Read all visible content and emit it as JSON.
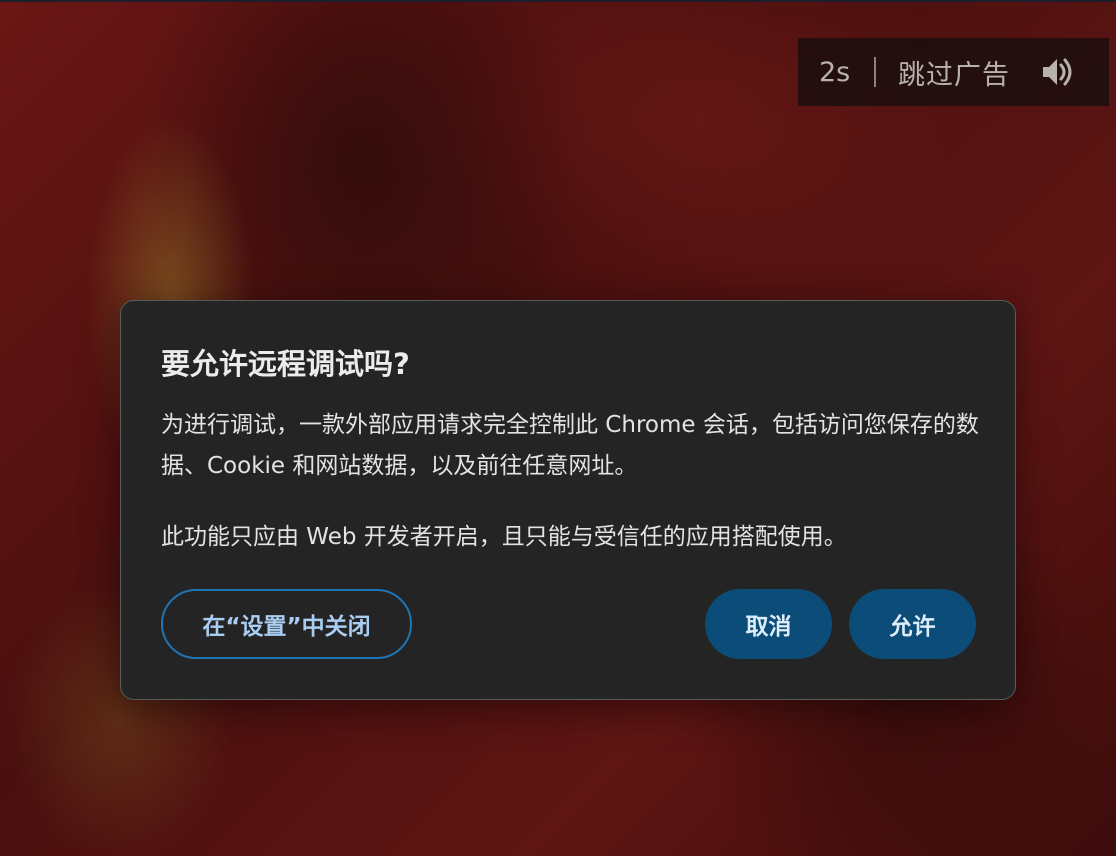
{
  "ad": {
    "countdown": "2s",
    "skip_label": "跳过广告",
    "speaker_icon": "speaker-icon"
  },
  "dialog": {
    "title": "要允许远程调试吗?",
    "body_line1": "为进行调试，一款外部应用请求完全控制此 Chrome 会话，包括访问您保存的数据、Cookie 和网站数据，以及前往任意网址。",
    "body_line2": "此功能只应由 Web 开发者开启，且只能与受信任的应用搭配使用。",
    "settings_button": "在“设置”中关闭",
    "cancel_button": "取消",
    "allow_button": "允许"
  },
  "colors": {
    "dialog_bg": "#242424",
    "primary_button": "#0b4c79",
    "outline_button_border": "#1f76b6"
  }
}
